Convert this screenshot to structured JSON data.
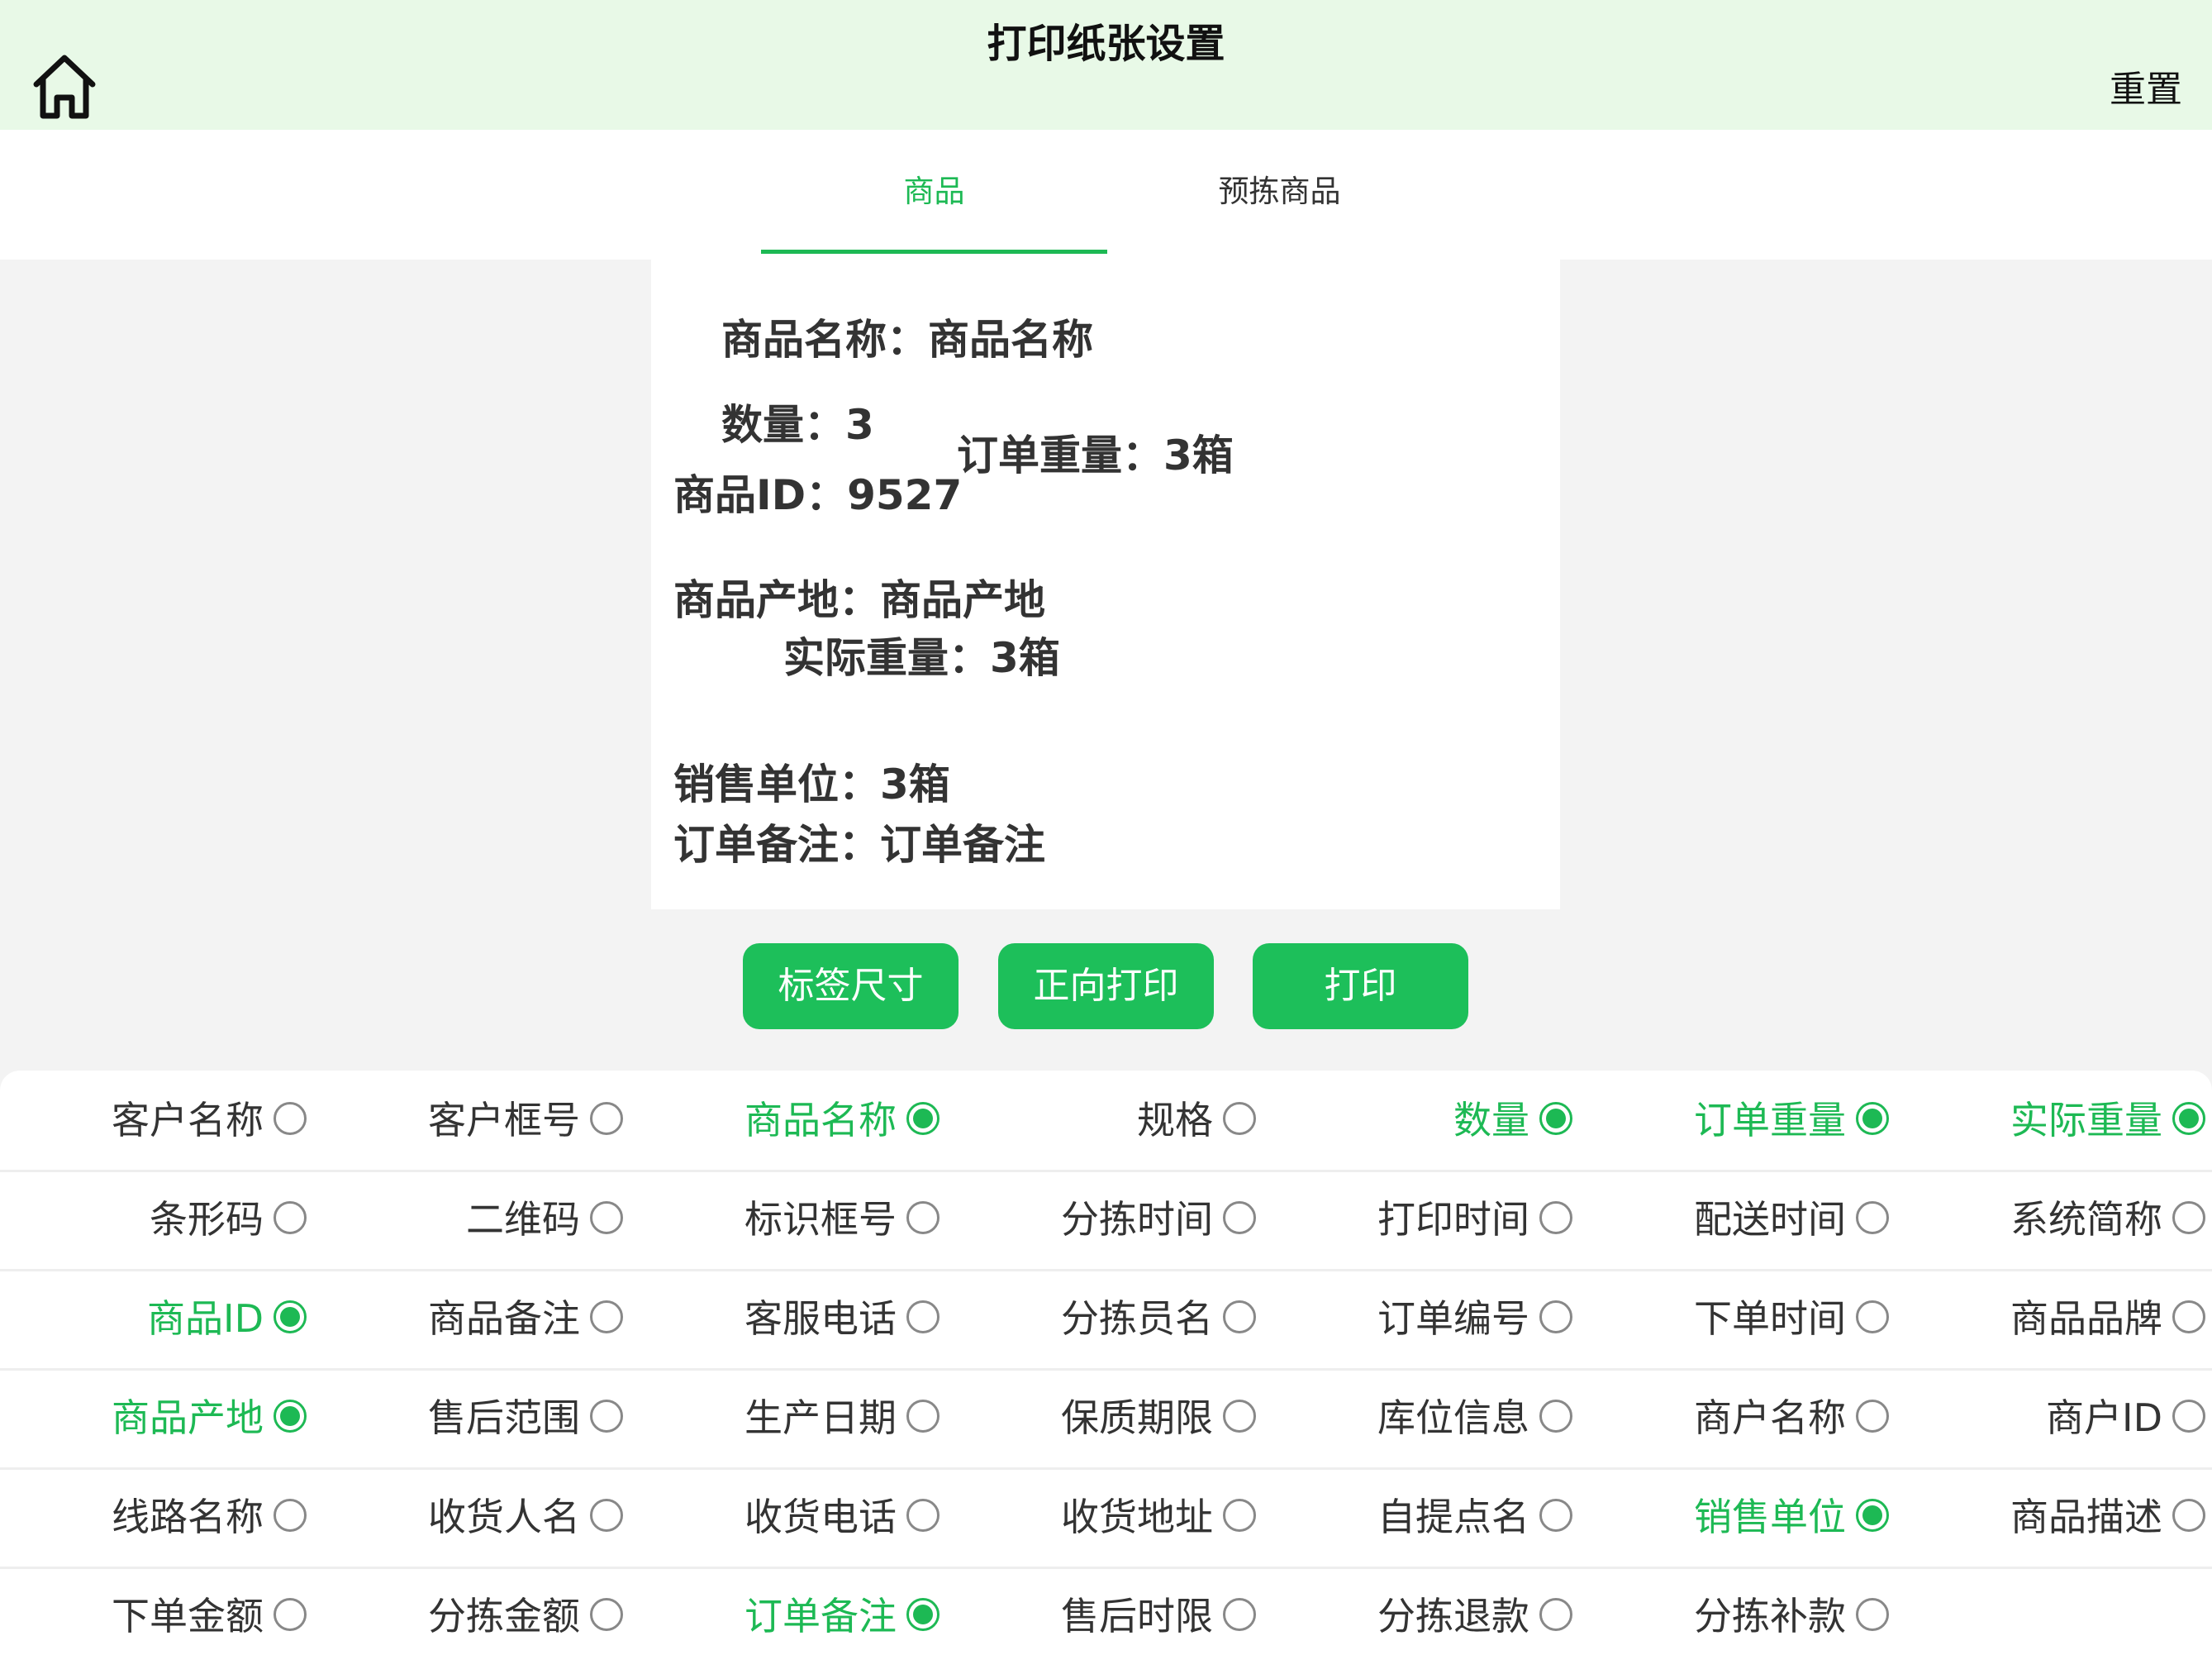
{
  "header": {
    "title": "打印纸张设置",
    "reset_label": "重置",
    "home_icon": "home-icon"
  },
  "tabs": [
    {
      "label": "商品",
      "active": true
    },
    {
      "label": "预拣商品",
      "active": false
    }
  ],
  "preview": {
    "product_name": "商品名称：商品名称",
    "quantity": "数量：3",
    "order_weight": "订单重量：3箱",
    "product_id": "商品ID：9527",
    "origin": "商品产地：商品产地",
    "actual_weight": "实际重量：3箱",
    "sales_unit": "销售单位：3箱",
    "order_note": "订单备注：订单备注"
  },
  "actions": {
    "label_size": "标签尺寸",
    "forward_print": "正向打印",
    "print": "打印"
  },
  "colors": {
    "accent": "#1db954",
    "header_bg": "#e8f9e7",
    "page_bg": "#f3f3f3"
  },
  "options": [
    [
      {
        "label": "客户名称",
        "on": false
      },
      {
        "label": "客户框号",
        "on": false
      },
      {
        "label": "商品名称",
        "on": true
      },
      {
        "label": "规格",
        "on": false
      },
      {
        "label": "数量",
        "on": true
      },
      {
        "label": "订单重量",
        "on": true
      },
      {
        "label": "实际重量",
        "on": true
      }
    ],
    [
      {
        "label": "条形码",
        "on": false
      },
      {
        "label": "二维码",
        "on": false
      },
      {
        "label": "标识框号",
        "on": false
      },
      {
        "label": "分拣时间",
        "on": false
      },
      {
        "label": "打印时间",
        "on": false
      },
      {
        "label": "配送时间",
        "on": false
      },
      {
        "label": "系统简称",
        "on": false
      }
    ],
    [
      {
        "label": "商品ID",
        "on": true
      },
      {
        "label": "商品备注",
        "on": false
      },
      {
        "label": "客服电话",
        "on": false
      },
      {
        "label": "分拣员名",
        "on": false
      },
      {
        "label": "订单编号",
        "on": false
      },
      {
        "label": "下单时间",
        "on": false
      },
      {
        "label": "商品品牌",
        "on": false
      }
    ],
    [
      {
        "label": "商品产地",
        "on": true
      },
      {
        "label": "售后范围",
        "on": false
      },
      {
        "label": "生产日期",
        "on": false
      },
      {
        "label": "保质期限",
        "on": false
      },
      {
        "label": "库位信息",
        "on": false
      },
      {
        "label": "商户名称",
        "on": false
      },
      {
        "label": "商户ID",
        "on": false
      }
    ],
    [
      {
        "label": "线路名称",
        "on": false
      },
      {
        "label": "收货人名",
        "on": false
      },
      {
        "label": "收货电话",
        "on": false
      },
      {
        "label": "收货地址",
        "on": false
      },
      {
        "label": "自提点名",
        "on": false
      },
      {
        "label": "销售单位",
        "on": true
      },
      {
        "label": "商品描述",
        "on": false
      }
    ],
    [
      {
        "label": "下单金额",
        "on": false
      },
      {
        "label": "分拣金额",
        "on": false
      },
      {
        "label": "订单备注",
        "on": true
      },
      {
        "label": "售后时限",
        "on": false
      },
      {
        "label": "分拣退款",
        "on": false
      },
      {
        "label": "分拣补款",
        "on": false
      }
    ]
  ]
}
